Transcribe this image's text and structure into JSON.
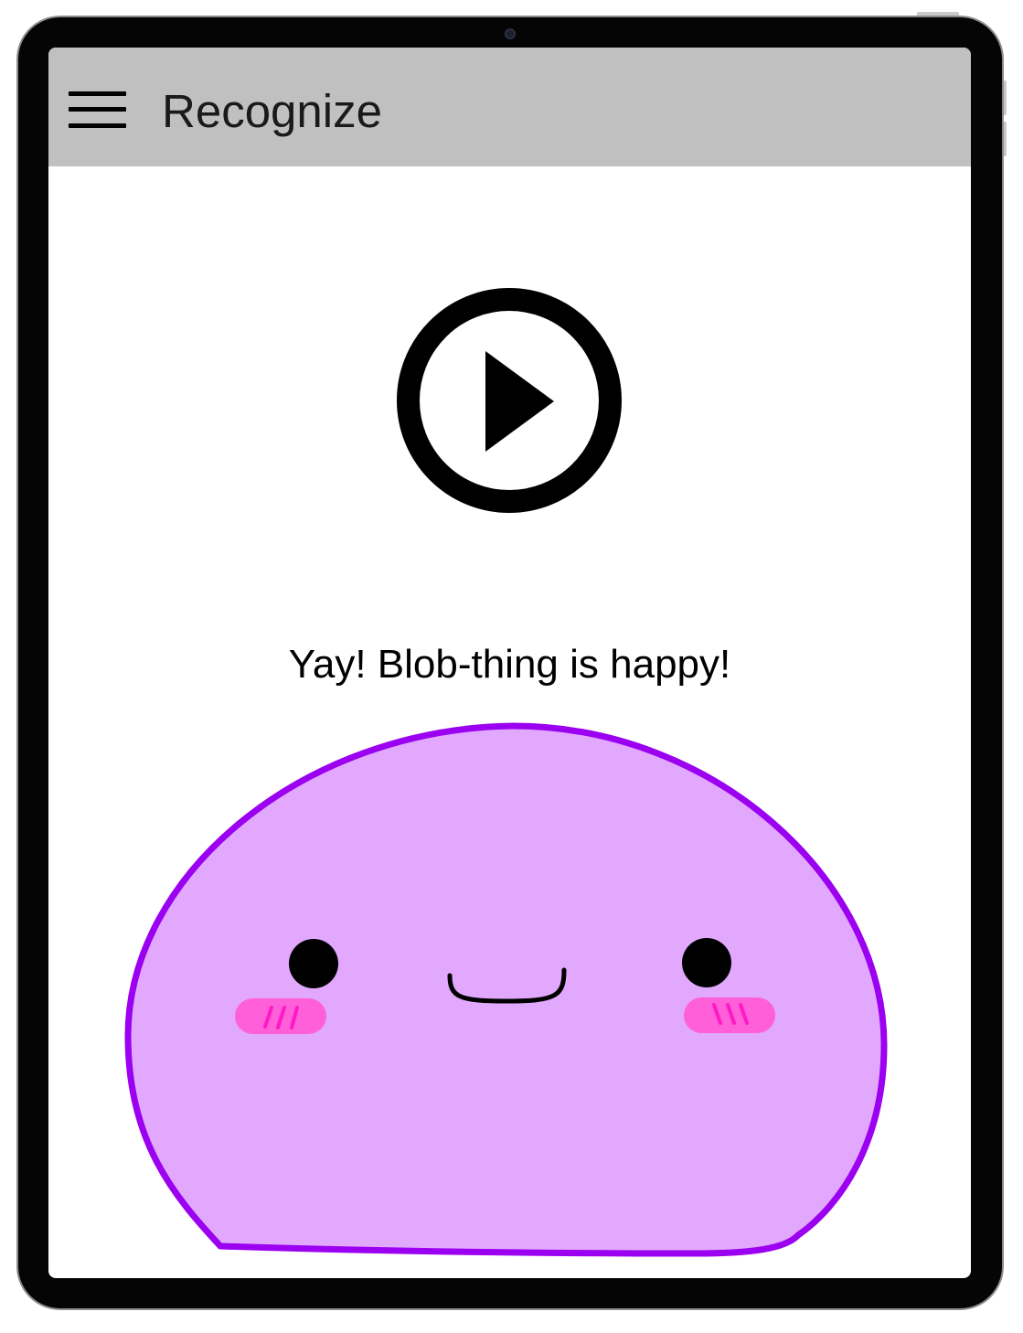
{
  "app": {
    "title": "Recognize"
  },
  "icons": {
    "menu": "hamburger-menu-icon",
    "play": "play-icon"
  },
  "main": {
    "status_text": "Yay! Blob-thing is happy!"
  },
  "colors": {
    "appbar": "#c0c0c0",
    "blob_fill": "#e1a8fd",
    "blob_outline": "#9b00f0",
    "cheek": "#ff5fd9",
    "cheek_stripe": "#ff19c5"
  }
}
